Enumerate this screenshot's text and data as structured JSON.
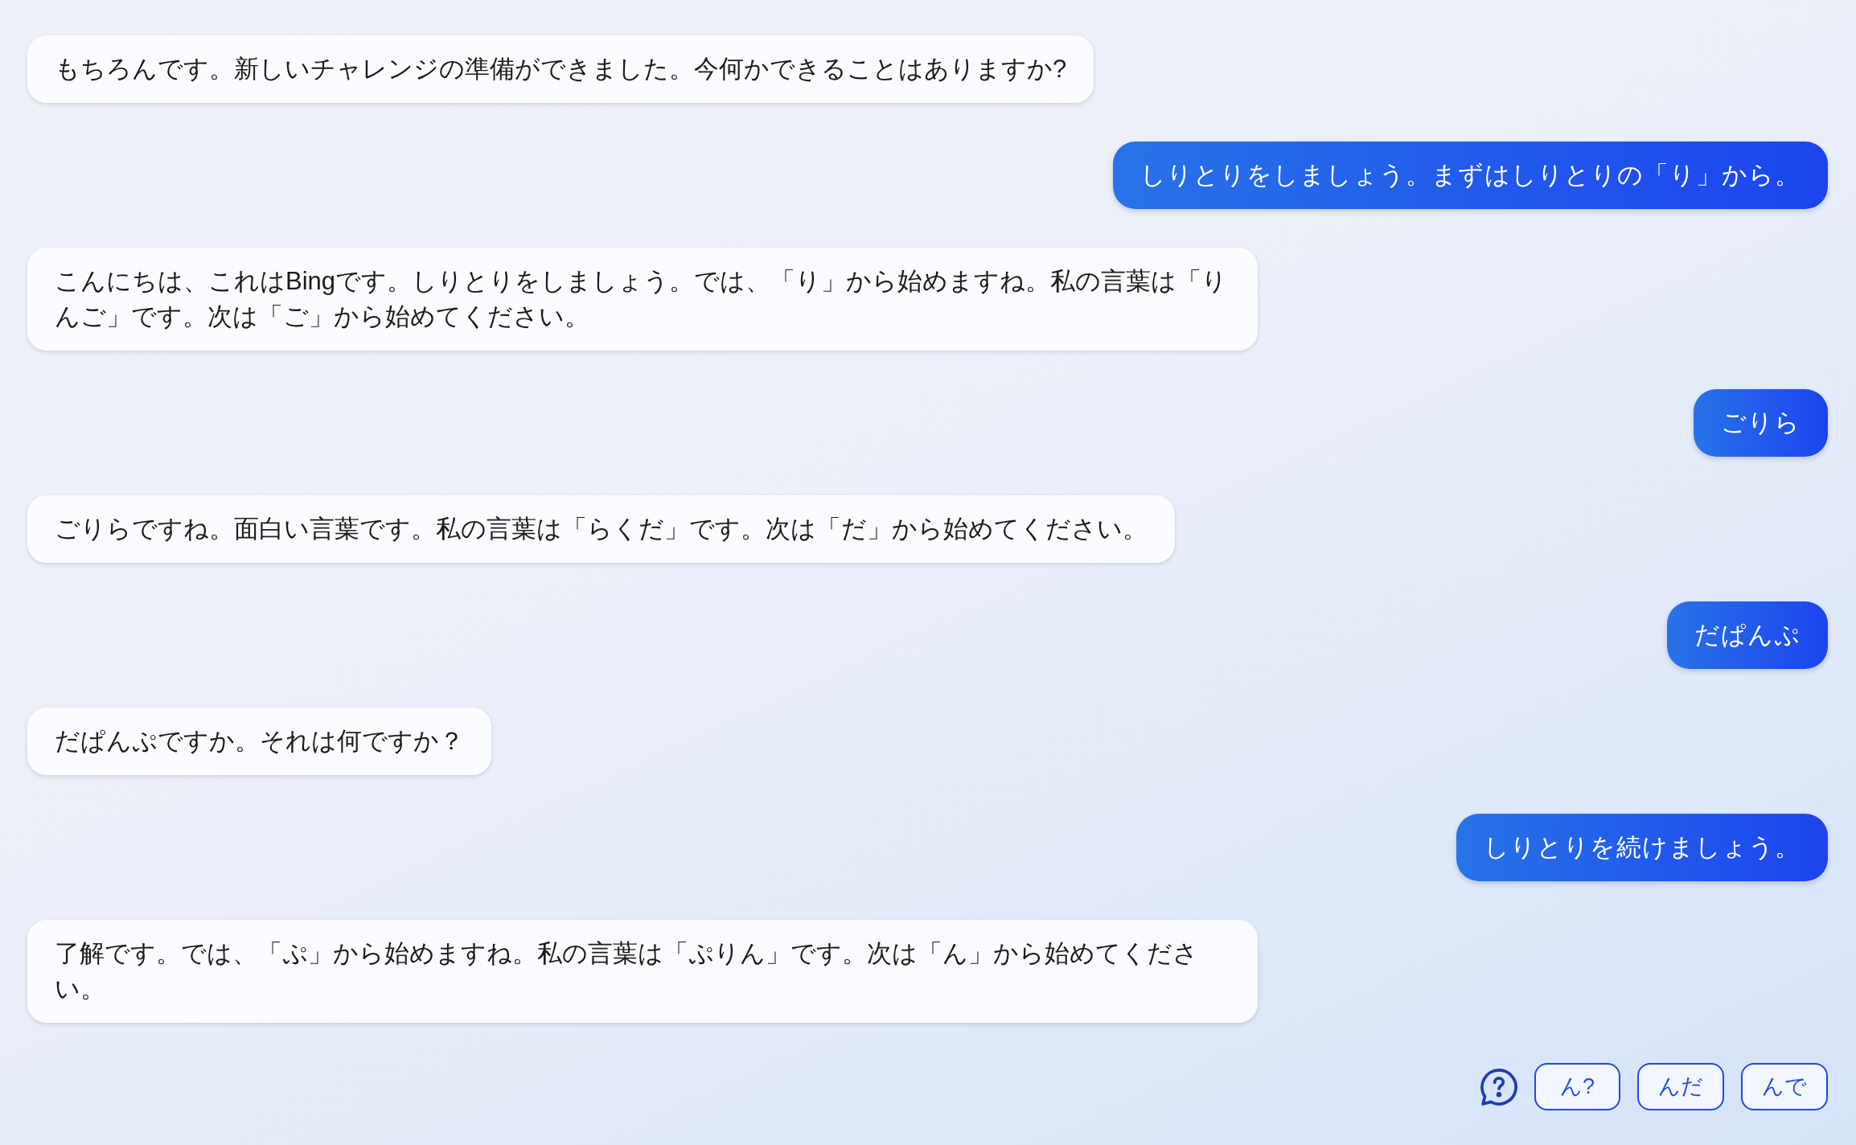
{
  "messages": [
    {
      "kind": "bot",
      "text": "もちろんです。新しいチャレンジの準備ができました。今何かできることはありますか?"
    },
    {
      "kind": "user",
      "text": "しりとりをしましょう。まずはしりとりの「り」から。"
    },
    {
      "kind": "bot",
      "text": "こんにちは、これはBingです。しりとりをしましょう。では、「り」から始めますね。私の言葉は「りんご」です。次は「ご」から始めてください。"
    },
    {
      "kind": "user",
      "text": "ごりら"
    },
    {
      "kind": "bot",
      "text": "ごりらですね。面白い言葉です。私の言葉は「らくだ」です。次は「だ」から始めてください。"
    },
    {
      "kind": "user",
      "text": "だぱんぷ"
    },
    {
      "kind": "bot",
      "text": "だぱんぷですか。それは何ですか？"
    },
    {
      "kind": "user",
      "text": "しりとりを続けましょう。"
    },
    {
      "kind": "bot",
      "text": "了解です。では、「ぷ」から始めますね。私の言葉は「ぷりん」です。次は「ん」から始めてください。"
    }
  ],
  "suggestions": [
    "ん?",
    "んだ",
    "んで"
  ]
}
